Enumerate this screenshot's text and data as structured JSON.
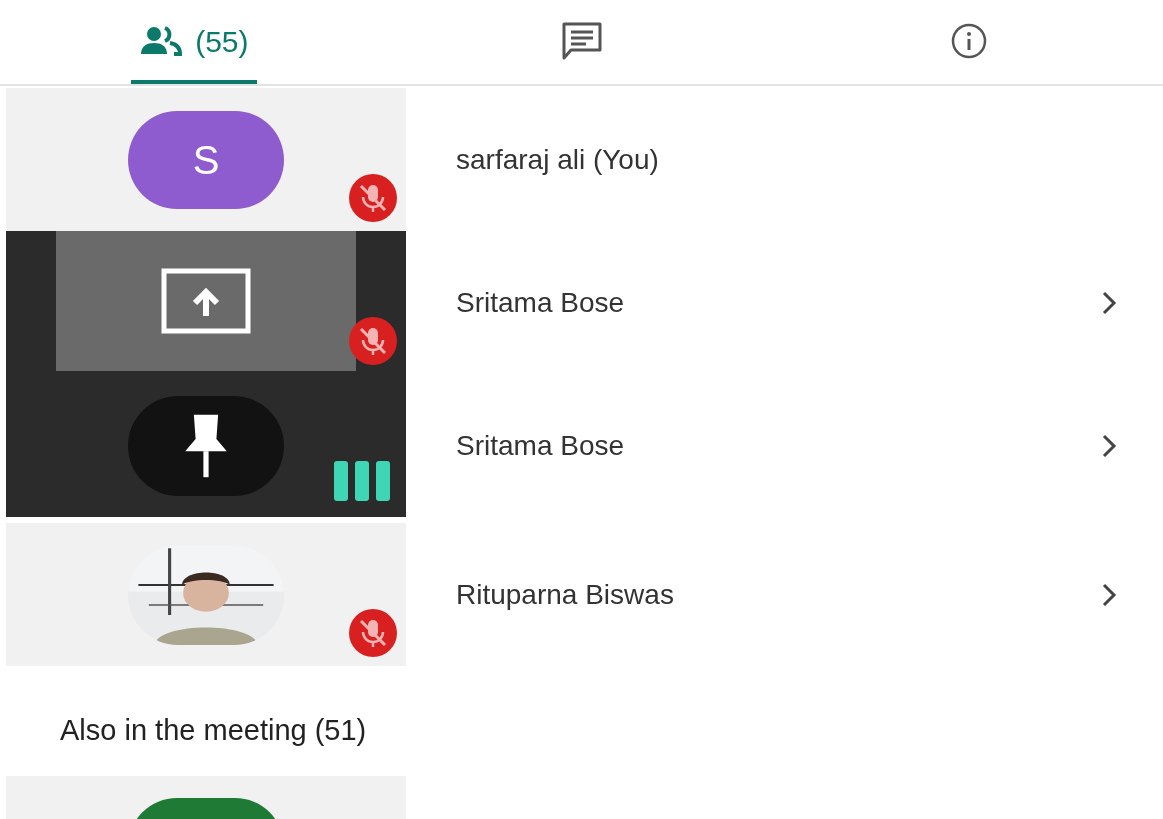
{
  "tabs": [
    {
      "kind": "people",
      "label": "(55)",
      "selected": true
    },
    {
      "kind": "chat",
      "selected": false
    },
    {
      "kind": "info",
      "selected": false
    }
  ],
  "participants": [
    {
      "name": "sarfaraj ali (You)",
      "tile": {
        "kind": "avatar",
        "letter": "S",
        "color": "#8e5ccf"
      },
      "badge": {
        "kind": "muted"
      },
      "chevron": false
    },
    {
      "name": "Sritama Bose",
      "tile": {
        "kind": "screen"
      },
      "badge": {
        "kind": "muted"
      },
      "chevron": true
    },
    {
      "name": "Sritama Bose",
      "tile": {
        "kind": "pin"
      },
      "badge": {
        "kind": "speaking"
      },
      "chevron": true
    },
    {
      "name": "Rituparna Biswas",
      "badge": {
        "kind": "muted"
      },
      "chevron": true
    }
  ],
  "also_heading": "Also in the meeting (51)",
  "others": [
    {
      "tile": {
        "kind": "avatar",
        "color": "#1e7a34"
      }
    }
  ]
}
